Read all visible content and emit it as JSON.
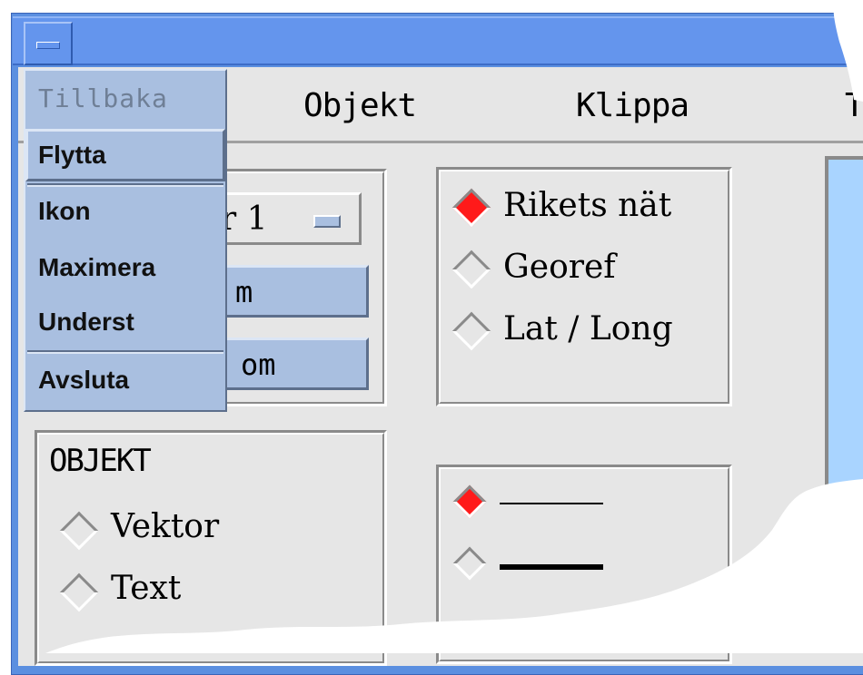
{
  "menubar": {
    "items": [
      "Objekt",
      "Klippa",
      "T"
    ]
  },
  "window_menu": {
    "items": [
      {
        "label": "Tillbaka",
        "state": "disabled"
      },
      {
        "label": "Flytta",
        "state": "selected"
      },
      {
        "label": "Ikon",
        "state": "normal"
      },
      {
        "label": "Maximera",
        "state": "normal"
      },
      {
        "label": "Underst",
        "state": "normal"
      },
      {
        "label": "Avsluta",
        "state": "normal"
      }
    ]
  },
  "layer_group": {
    "option_value": "r 1",
    "button1_label": "m",
    "button2_label": "om"
  },
  "coordinate_group": {
    "options": [
      {
        "label": "Rikets nät",
        "selected": true
      },
      {
        "label": "Georef",
        "selected": false
      },
      {
        "label": "Lat / Long",
        "selected": false
      }
    ]
  },
  "object_group": {
    "title": "OBJEKT",
    "options": [
      {
        "label": "Vektor",
        "selected": false
      },
      {
        "label": "Text",
        "selected": false
      }
    ]
  },
  "line_group": {
    "options": [
      {
        "style": "thin",
        "selected": true
      },
      {
        "style": "thick",
        "selected": false
      }
    ]
  },
  "colors": {
    "titlebar": "#6495ed",
    "menu_bg": "#a9bfe0",
    "client_bg": "#e6e6e6",
    "radio_selected": "#ff1a1a",
    "map_panel": "#a9d4ff"
  }
}
